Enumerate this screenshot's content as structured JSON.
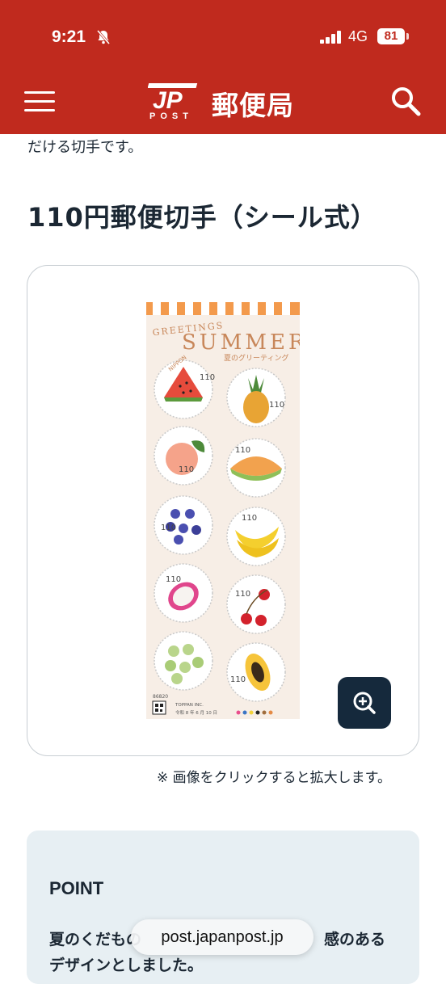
{
  "status_bar": {
    "time": "9:21",
    "network": "4G",
    "battery": "81"
  },
  "header": {
    "site_name": "郵便局",
    "logo_text": "JP",
    "logo_sub": "POST"
  },
  "content": {
    "intro_text": "だける切手です。",
    "heading": "110円郵便切手（シール式）",
    "zoom_note": "※ 画像をクリックすると拡大します。"
  },
  "stamp_sheet": {
    "greetings": "GREETINGS",
    "title": "SUMMER",
    "subtitle": "夏のグリーティング",
    "country": "NIPPON",
    "denomination": "110",
    "sheet_code": "86820",
    "printer": "TOPPAN INC.",
    "issue_date": "令和 8 年 6 月 10 日",
    "fruits": [
      "watermelon",
      "pineapple",
      "peach",
      "melon",
      "blueberry",
      "banana",
      "dragon fruit",
      "cherry",
      "muscat grapes",
      "papaya"
    ]
  },
  "point": {
    "title": "POINT",
    "text_line1": "夏のくだもの",
    "text_line1_end": "感のある",
    "text_line2": "デザインとしました。"
  },
  "browser": {
    "url": "post.japanpost.jp"
  }
}
